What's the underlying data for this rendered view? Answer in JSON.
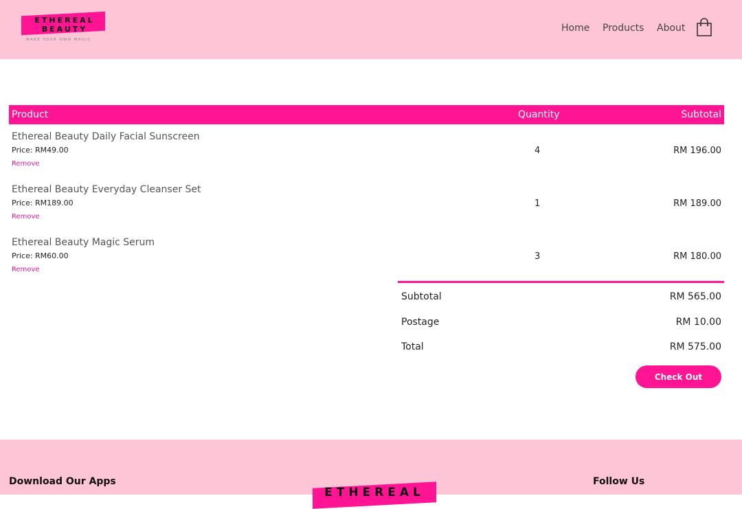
{
  "header": {
    "logo": {
      "line1": "ETHEREAL",
      "line2": "BEAUTY",
      "tagline": "MAKE YOUR OWN MAGIC"
    },
    "nav": [
      "Home",
      "Products",
      "About"
    ],
    "cart_icon": "shopping-bag-icon"
  },
  "cart": {
    "columns": {
      "product": "Product",
      "quantity": "Quantity",
      "subtotal": "Subtotal"
    },
    "items": [
      {
        "name": "Ethereal Beauty Daily Facial Sunscreen",
        "price": "Price: RM49.00",
        "remove": "Remove",
        "quantity": "4",
        "subtotal": "RM 196.00"
      },
      {
        "name": "Ethereal Beauty Everyday Cleanser Set",
        "price": "Price: RM189.00",
        "remove": "Remove",
        "quantity": "1",
        "subtotal": "RM 189.00"
      },
      {
        "name": "Ethereal Beauty Magic Serum",
        "price": "Price: RM60.00",
        "remove": "Remove",
        "quantity": "3",
        "subtotal": "RM 180.00"
      }
    ],
    "totals": [
      {
        "label": "Subtotal",
        "value": "RM 565.00"
      },
      {
        "label": "Postage",
        "value": "RM 10.00"
      },
      {
        "label": "Total",
        "value": "RM 575.00"
      }
    ],
    "checkout_label": "Check Out"
  },
  "footer": {
    "apps_heading": "Download Our Apps",
    "logo_text": "ETHEREAL",
    "follow_heading": "Follow Us"
  },
  "colors": {
    "accent": "#ff1493",
    "header_bg": "#fdc5d6",
    "remove_link": "#e8198f"
  }
}
